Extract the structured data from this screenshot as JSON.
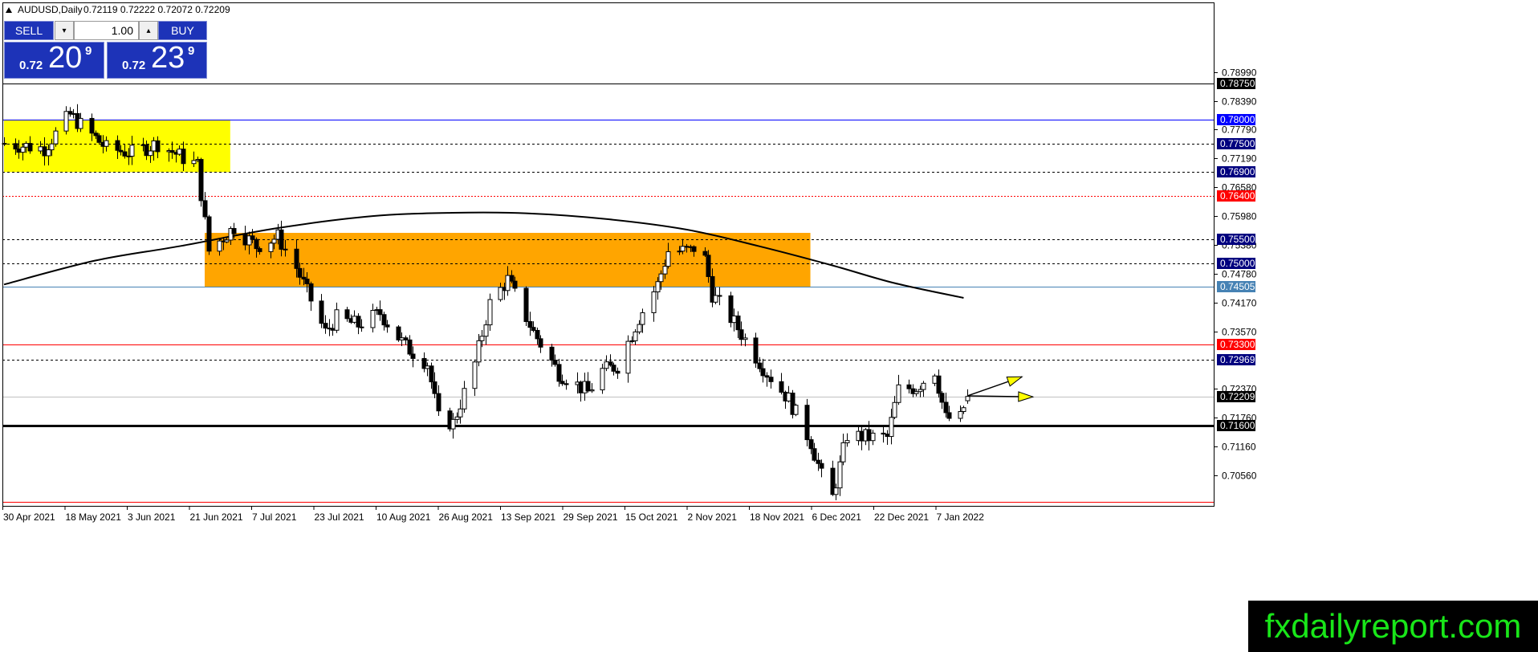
{
  "header": {
    "symbol": "AUDUSD,Daily",
    "ohlc": "0.72119 0.72222 0.72072 0.72209"
  },
  "trade_panel": {
    "sell_label": "SELL",
    "buy_label": "BUY",
    "lot_value": "1.00",
    "down_arrow": "▾",
    "up_arrow": "▴",
    "sell_price_small": "0.72",
    "sell_price_big": "20",
    "sell_price_sup": "9",
    "buy_price_small": "0.72",
    "buy_price_big": "23",
    "buy_price_sup": "9"
  },
  "brand": {
    "text": "fxdailyreport.com"
  },
  "colors": {
    "bg": "#ffffff",
    "yellow_zone": "#ffff00",
    "orange_zone": "#ffa500",
    "candle": "#000000",
    "ma": "#000000",
    "red_level": "#ff0000",
    "blue_level": "#0000ff",
    "arrow": "#ffff00",
    "label_blue": "#00007f",
    "label_red": "#ff0000",
    "label_black": "#000000",
    "label_steel": "#4682b4",
    "brand_green": "#19e619"
  },
  "chart_data": {
    "type": "candlestick",
    "ylim": [
      0.6992,
      0.8045
    ],
    "y_ticks": [
      "0.78990",
      "0.78390",
      "0.77790",
      "0.77190",
      "0.76580",
      "0.75980",
      "0.75380",
      "0.74780",
      "0.74170",
      "0.73570",
      "0.72370",
      "0.71760",
      "0.71160",
      "0.70560"
    ],
    "x_ticks": [
      "30 Apr 2021",
      "18 May 2021",
      "3 Jun 2021",
      "21 Jun 2021",
      "7 Jul 2021",
      "23 Jul 2021",
      "10 Aug 2021",
      "26 Aug 2021",
      "13 Sep 2021",
      "29 Sep 2021",
      "15 Oct 2021",
      "2 Nov 2021",
      "18 Nov 2021",
      "6 Dec 2021",
      "22 Dec 2021",
      "7 Jan 2022"
    ],
    "levels": [
      {
        "price": 0.7875,
        "label": "0.78750",
        "style": "solid",
        "color": "#000000",
        "label_bg": "#000000"
      },
      {
        "price": 0.78,
        "label": "0.78000",
        "style": "solid",
        "color": "#0000ff",
        "label_bg": "#0000ff"
      },
      {
        "price": 0.775,
        "label": "0.77500",
        "style": "dashed",
        "color": "#000000",
        "label_bg": "#00007f"
      },
      {
        "price": 0.769,
        "label": "0.76900",
        "style": "dashed",
        "color": "#000000",
        "label_bg": "#00007f"
      },
      {
        "price": 0.764,
        "label": "0.76400",
        "style": "dotted",
        "color": "#ff0000",
        "label_bg": "#ff0000"
      },
      {
        "price": 0.755,
        "label": "0.75500",
        "style": "dashed",
        "color": "#000000",
        "label_bg": "#00007f"
      },
      {
        "price": 0.75,
        "label": "0.75000",
        "style": "dashed",
        "color": "#000000",
        "label_bg": "#00007f"
      },
      {
        "price": 0.74505,
        "label": "0.74505",
        "style": "solid",
        "color": "#4682b4",
        "label_bg": "#4682b4"
      },
      {
        "price": 0.733,
        "label": "0.73300",
        "style": "solid",
        "color": "#ff0000",
        "label_bg": "#ff0000"
      },
      {
        "price": 0.72969,
        "label": "0.72969",
        "style": "dashed",
        "color": "#000000",
        "label_bg": "#00007f"
      },
      {
        "price": 0.72209,
        "label": "0.72209",
        "style": "solid",
        "color": "#c0c0c0",
        "label_bg": "#000000"
      },
      {
        "price": 0.716,
        "label": "0.71600",
        "style": "thick",
        "color": "#000000",
        "label_bg": "#000000"
      },
      {
        "price": 0.7,
        "label": "",
        "style": "solid",
        "color": "#ff0000",
        "label_bg": ""
      }
    ],
    "zones": [
      {
        "name": "yellow",
        "date_from": "2021-04-23",
        "date_to": "2021-06-24",
        "price_from": 0.769,
        "price_to": 0.78,
        "color": "#ffff00"
      },
      {
        "name": "orange",
        "date_from": "2021-06-17",
        "date_to": "2021-11-30",
        "price_from": 0.74505,
        "price_to": 0.7563,
        "color": "#ffa500"
      }
    ],
    "moving_average": [
      [
        "2021-04-23",
        0.7455
      ],
      [
        "2021-05-18",
        0.7505
      ],
      [
        "2021-06-10",
        0.7535
      ],
      [
        "2021-07-07",
        0.7573
      ],
      [
        "2021-08-02",
        0.7598
      ],
      [
        "2021-08-24",
        0.7605
      ],
      [
        "2021-09-13",
        0.7604
      ],
      [
        "2021-10-05",
        0.7592
      ],
      [
        "2021-10-27",
        0.757
      ],
      [
        "2021-11-16",
        0.7535
      ],
      [
        "2021-12-06",
        0.7495
      ],
      [
        "2021-12-23",
        0.7458
      ],
      [
        "2022-01-11",
        0.7427
      ]
    ],
    "candles_anchor": [
      [
        "2021-04-23",
        0.775
      ],
      [
        "2021-05-04",
        0.774
      ],
      [
        "2021-05-11",
        0.781
      ],
      [
        "2021-05-21",
        0.774
      ],
      [
        "2021-05-28",
        0.773
      ],
      [
        "2021-06-04",
        0.775
      ],
      [
        "2021-06-11",
        0.772
      ],
      [
        "2021-06-15",
        0.7705
      ],
      [
        "2021-06-18",
        0.7525
      ],
      [
        "2021-06-25",
        0.7575
      ],
      [
        "2021-07-01",
        0.7535
      ],
      [
        "2021-07-07",
        0.7555
      ],
      [
        "2021-07-12",
        0.749
      ],
      [
        "2021-07-20",
        0.7355
      ],
      [
        "2021-07-23",
        0.7385
      ],
      [
        "2021-07-29",
        0.737
      ],
      [
        "2021-08-04",
        0.7395
      ],
      [
        "2021-08-11",
        0.7325
      ],
      [
        "2021-08-17",
        0.729
      ],
      [
        "2021-08-20",
        0.7175
      ],
      [
        "2021-08-24",
        0.7165
      ],
      [
        "2021-08-30",
        0.729
      ],
      [
        "2021-09-03",
        0.7415
      ],
      [
        "2021-09-08",
        0.7465
      ],
      [
        "2021-09-15",
        0.7355
      ],
      [
        "2021-09-22",
        0.727
      ],
      [
        "2021-09-30",
        0.723
      ],
      [
        "2021-10-04",
        0.7275
      ],
      [
        "2021-10-08",
        0.7285
      ],
      [
        "2021-10-14",
        0.7385
      ],
      [
        "2021-10-19",
        0.7455
      ],
      [
        "2021-10-22",
        0.7525
      ],
      [
        "2021-10-28",
        0.7525
      ],
      [
        "2021-10-31",
        0.7545
      ],
      [
        "2021-11-03",
        0.7435
      ],
      [
        "2021-11-09",
        0.7375
      ],
      [
        "2021-11-12",
        0.734
      ],
      [
        "2021-11-18",
        0.727
      ],
      [
        "2021-11-24",
        0.7215
      ],
      [
        "2021-11-30",
        0.7125
      ],
      [
        "2021-12-03",
        0.7055
      ],
      [
        "2021-12-06",
        0.701
      ],
      [
        "2021-12-10",
        0.714
      ],
      [
        "2021-12-16",
        0.7135
      ],
      [
        "2021-12-21",
        0.7135
      ],
      [
        "2021-12-24",
        0.7235
      ],
      [
        "2021-12-29",
        0.724
      ],
      [
        "2022-01-03",
        0.7275
      ],
      [
        "2022-01-06",
        0.7175
      ],
      [
        "2022-01-10",
        0.7175
      ],
      [
        "2022-01-12",
        0.72209
      ]
    ],
    "arrows": [
      {
        "from": [
          "2022-01-12",
          0.7222
        ],
        "to": [
          "2022-01-27",
          0.7262
        ]
      },
      {
        "from": [
          "2022-01-12",
          0.7222
        ],
        "to": [
          "2022-01-30",
          0.722
        ]
      }
    ]
  }
}
